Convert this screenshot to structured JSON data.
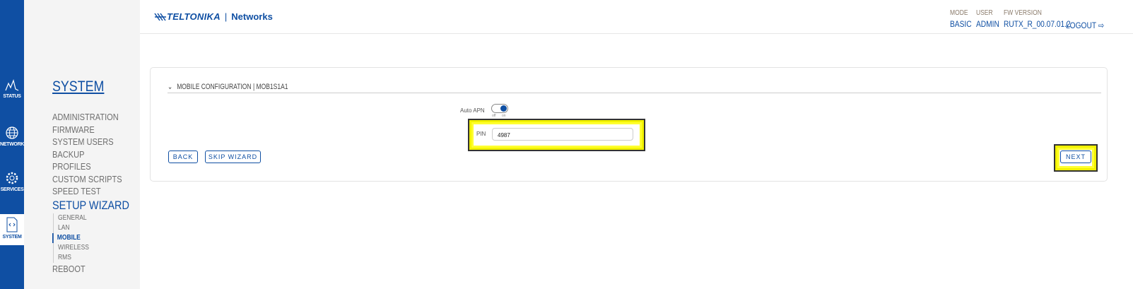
{
  "rail": [
    {
      "label": "STATUS",
      "icon": "activity-icon"
    },
    {
      "label": "NETWORK",
      "icon": "globe-icon"
    },
    {
      "label": "SERVICES",
      "icon": "gear-icon"
    },
    {
      "label": "SYSTEM",
      "icon": "code-file-icon"
    }
  ],
  "sidebar": {
    "title": "SYSTEM",
    "items": [
      "ADMINISTRATION",
      "FIRMWARE",
      "SYSTEM USERS",
      "BACKUP",
      "PROFILES",
      "CUSTOM SCRIPTS",
      "SPEED TEST"
    ],
    "current": "SETUP WIZARD",
    "subitems": [
      "GENERAL",
      "LAN",
      "MOBILE",
      "WIRELESS",
      "RMS"
    ],
    "after": "REBOOT"
  },
  "header": {
    "brand": "TELTONIKA",
    "product": "Networks",
    "mode_label": "MODE",
    "mode": "BASIC",
    "user_label": "USER",
    "user": "ADMIN",
    "fw_label": "FW VERSION",
    "fw": "RUTX_R_00.07.01.2",
    "logout": "LOGOUT"
  },
  "card": {
    "title": "MOBILE CONFIGURATION | MOB1S1A1",
    "auto_apn_label": "Auto APN",
    "toggle_off": "off",
    "toggle_on": "on",
    "auto_apn_on": true,
    "pin_label": "PIN",
    "pin_value": "4987",
    "back": "BACK",
    "skip": "SKIP WIZARD",
    "next": "NEXT"
  },
  "colors": {
    "accent": "#0f4fa3",
    "highlight": "#f2f200"
  }
}
